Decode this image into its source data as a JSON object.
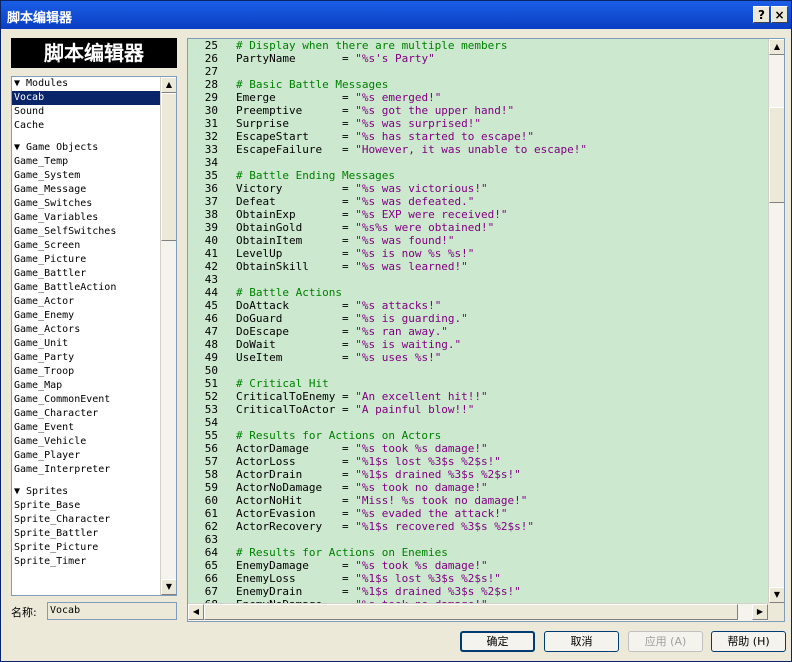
{
  "window": {
    "title": "脚本编辑器",
    "help_btn": "?",
    "close_btn": "×"
  },
  "logo": "脚本编辑器",
  "modules": [
    {
      "label": "▼ Modules",
      "type": "group"
    },
    {
      "label": "Vocab",
      "selected": true
    },
    {
      "label": "Sound"
    },
    {
      "label": "Cache"
    },
    {
      "gap": true
    },
    {
      "label": "▼ Game Objects",
      "type": "group"
    },
    {
      "label": "Game_Temp"
    },
    {
      "label": "Game_System"
    },
    {
      "label": "Game_Message"
    },
    {
      "label": "Game_Switches"
    },
    {
      "label": "Game_Variables"
    },
    {
      "label": "Game_SelfSwitches"
    },
    {
      "label": "Game_Screen"
    },
    {
      "label": "Game_Picture"
    },
    {
      "label": "Game_Battler"
    },
    {
      "label": "Game_BattleAction"
    },
    {
      "label": "Game_Actor"
    },
    {
      "label": "Game_Enemy"
    },
    {
      "label": "Game_Actors"
    },
    {
      "label": "Game_Unit"
    },
    {
      "label": "Game_Party"
    },
    {
      "label": "Game_Troop"
    },
    {
      "label": "Game_Map"
    },
    {
      "label": "Game_CommonEvent"
    },
    {
      "label": "Game_Character"
    },
    {
      "label": "Game_Event"
    },
    {
      "label": "Game_Vehicle"
    },
    {
      "label": "Game_Player"
    },
    {
      "label": "Game_Interpreter"
    },
    {
      "gap": true
    },
    {
      "label": "▼ Sprites",
      "type": "group"
    },
    {
      "label": "Sprite_Base"
    },
    {
      "label": "Sprite_Character"
    },
    {
      "label": "Sprite_Battler"
    },
    {
      "label": "Sprite_Picture"
    },
    {
      "label": "Sprite_Timer"
    }
  ],
  "name_label": "名称:",
  "name_value": "Vocab",
  "code_lines": [
    {
      "n": "25",
      "t": "# Display when there are multiple members",
      "k": "comment"
    },
    {
      "n": "26",
      "t": "PartyName       = \"%s's Party\"",
      "k": "code"
    },
    {
      "n": "27",
      "t": "",
      "k": "code"
    },
    {
      "n": "28",
      "t": "# Basic Battle Messages",
      "k": "comment"
    },
    {
      "n": "29",
      "t": "Emerge          = \"%s emerged!\"",
      "k": "code"
    },
    {
      "n": "30",
      "t": "Preemptive      = \"%s got the upper hand!\"",
      "k": "code"
    },
    {
      "n": "31",
      "t": "Surprise        = \"%s was surprised!\"",
      "k": "code"
    },
    {
      "n": "32",
      "t": "EscapeStart     = \"%s has started to escape!\"",
      "k": "code"
    },
    {
      "n": "33",
      "t": "EscapeFailure   = \"However, it was unable to escape!\"",
      "k": "code"
    },
    {
      "n": "34",
      "t": "",
      "k": "code"
    },
    {
      "n": "35",
      "t": "# Battle Ending Messages",
      "k": "comment"
    },
    {
      "n": "36",
      "t": "Victory         = \"%s was victorious!\"",
      "k": "code"
    },
    {
      "n": "37",
      "t": "Defeat          = \"%s was defeated.\"",
      "k": "code"
    },
    {
      "n": "38",
      "t": "ObtainExp       = \"%s EXP were received!\"",
      "k": "code"
    },
    {
      "n": "39",
      "t": "ObtainGold      = \"%s%s were obtained!\"",
      "k": "code"
    },
    {
      "n": "40",
      "t": "ObtainItem      = \"%s was found!\"",
      "k": "code"
    },
    {
      "n": "41",
      "t": "LevelUp         = \"%s is now %s %s!\"",
      "k": "code"
    },
    {
      "n": "42",
      "t": "ObtainSkill     = \"%s was learned!\"",
      "k": "code"
    },
    {
      "n": "43",
      "t": "",
      "k": "code"
    },
    {
      "n": "44",
      "t": "# Battle Actions",
      "k": "comment"
    },
    {
      "n": "45",
      "t": "DoAttack        = \"%s attacks!\"",
      "k": "code"
    },
    {
      "n": "46",
      "t": "DoGuard         = \"%s is guarding.\"",
      "k": "code"
    },
    {
      "n": "47",
      "t": "DoEscape        = \"%s ran away.\"",
      "k": "code"
    },
    {
      "n": "48",
      "t": "DoWait          = \"%s is waiting.\"",
      "k": "code"
    },
    {
      "n": "49",
      "t": "UseItem         = \"%s uses %s!\"",
      "k": "code"
    },
    {
      "n": "50",
      "t": "",
      "k": "code"
    },
    {
      "n": "51",
      "t": "# Critical Hit",
      "k": "comment"
    },
    {
      "n": "52",
      "t": "CriticalToEnemy = \"An excellent hit!!\"",
      "k": "code"
    },
    {
      "n": "53",
      "t": "CriticalToActor = \"A painful blow!!\"",
      "k": "code"
    },
    {
      "n": "54",
      "t": "",
      "k": "code"
    },
    {
      "n": "55",
      "t": "# Results for Actions on Actors",
      "k": "comment"
    },
    {
      "n": "56",
      "t": "ActorDamage     = \"%s took %s damage!\"",
      "k": "code"
    },
    {
      "n": "57",
      "t": "ActorLoss       = \"%1$s lost %3$s %2$s!\"",
      "k": "code"
    },
    {
      "n": "58",
      "t": "ActorDrain      = \"%1$s drained %3$s %2$s!\"",
      "k": "code"
    },
    {
      "n": "59",
      "t": "ActorNoDamage   = \"%s took no damage!\"",
      "k": "code"
    },
    {
      "n": "60",
      "t": "ActorNoHit      = \"Miss! %s took no damage!\"",
      "k": "code"
    },
    {
      "n": "61",
      "t": "ActorEvasion    = \"%s evaded the attack!\"",
      "k": "code"
    },
    {
      "n": "62",
      "t": "ActorRecovery   = \"%1$s recovered %3$s %2$s!\"",
      "k": "code"
    },
    {
      "n": "63",
      "t": "",
      "k": "code"
    },
    {
      "n": "64",
      "t": "# Results for Actions on Enemies",
      "k": "comment"
    },
    {
      "n": "65",
      "t": "EnemyDamage     = \"%s took %s damage!\"",
      "k": "code"
    },
    {
      "n": "66",
      "t": "EnemyLoss       = \"%1$s lost %3$s %2$s!\"",
      "k": "code"
    },
    {
      "n": "67",
      "t": "EnemyDrain      = \"%1$s drained %3$s %2$s!\"",
      "k": "code"
    },
    {
      "n": "68",
      "t": "EnemyNoDamage   = \"%s took no damage!\"",
      "k": "code"
    }
  ],
  "buttons": {
    "ok": "确定",
    "cancel": "取消",
    "apply": "应用 (A)",
    "help": "帮助 (H)"
  },
  "colors": {
    "editor_bg": "#cce8cf",
    "comment": "#008000",
    "string": "#800080",
    "selection": "#0a246a"
  }
}
